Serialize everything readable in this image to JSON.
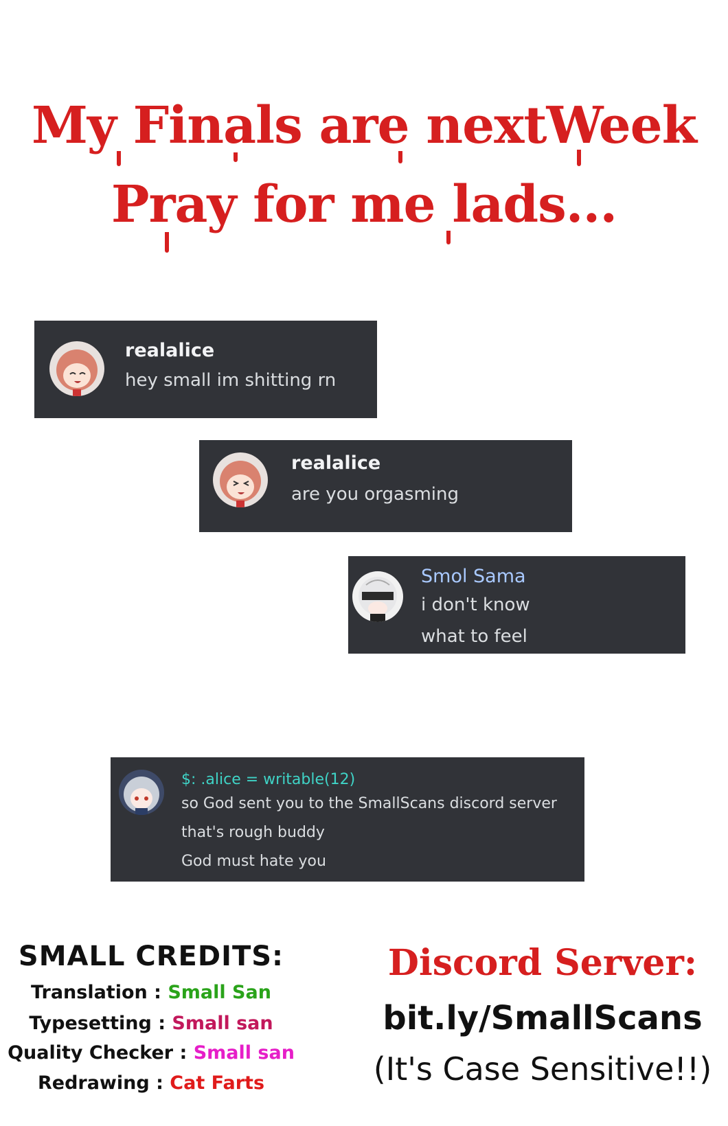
{
  "headline": {
    "line1": "My Finals are nextWeek",
    "line2": "Pray for me lads..."
  },
  "messages": [
    {
      "username": "realalice",
      "username_color": "#f2f3f5",
      "avatar": "pink-haired-anime-girl-avatar",
      "lines": [
        "hey small im shitting rn"
      ]
    },
    {
      "username": "realalice",
      "username_color": "#f2f3f5",
      "avatar": "pink-haired-anime-girl-avatar",
      "lines": [
        "are you orgasming"
      ]
    },
    {
      "username": "Smol Sama",
      "username_color": "#a9c9ff",
      "avatar": "white-haired-blindfold-avatar",
      "lines": [
        "i don't know",
        "what to feel"
      ]
    },
    {
      "username": "$: .alice = writable(12)",
      "username_color": "#3fd3c6",
      "avatar": "silver-haired-anime-girl-avatar",
      "lines": [
        "so God sent you to the SmallScans discord server",
        "that's rough buddy",
        "God must hate you"
      ]
    }
  ],
  "credits": {
    "title": "SMALL CREDITS:",
    "rows": [
      {
        "role": "Translation :",
        "name": "Small San",
        "color": "#2aa31a"
      },
      {
        "role": "Typesetting :",
        "name": "Small san",
        "color": "#c2185b"
      },
      {
        "role": "Quality Checker :",
        "name": "Small san",
        "color": "#e61ec8"
      },
      {
        "role": "Redrawing :",
        "name": "Cat Farts",
        "color": "#e01b1b"
      }
    ]
  },
  "discord": {
    "title": "Discord Server:",
    "link": "bit.ly/SmallScans",
    "note": "(It's Case Sensitive!!)"
  },
  "colors": {
    "accent_red": "#d61f1f",
    "message_bg": "#313338"
  }
}
